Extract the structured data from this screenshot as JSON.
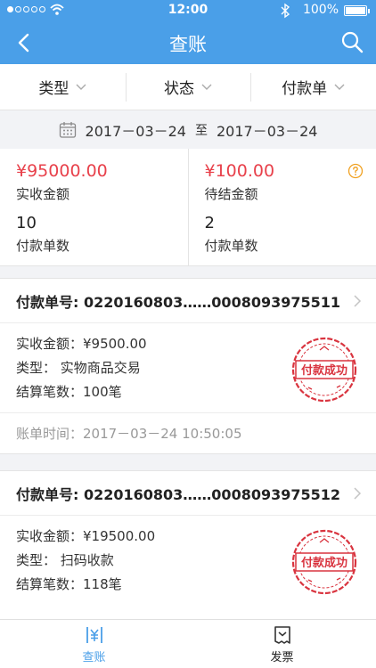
{
  "status_bar": {
    "time": "12:00",
    "battery": "100%"
  },
  "nav": {
    "title": "查账"
  },
  "filters": [
    {
      "label": "类型"
    },
    {
      "label": "状态"
    },
    {
      "label": "付款单"
    }
  ],
  "date_range": {
    "start": "2017－03－24",
    "separator": "至",
    "end": "2017－03－24"
  },
  "summary": {
    "received_amount": "¥95000.00",
    "received_label": "实收金额",
    "received_count": "10",
    "received_count_label": "付款单数",
    "pending_amount": "¥100.00",
    "pending_label": "待结金额",
    "pending_count": "2",
    "pending_count_label": "付款单数"
  },
  "cards": [
    {
      "order_no": "付款单号: 0220160803……0008093975511",
      "amount": "实收金额：¥9500.00",
      "type": "类型：  实物商品交易",
      "settle": "结算笔数：100笔",
      "stamp": "付款成功",
      "bill_time": "账单时间：2017－03－24  10:50:05"
    },
    {
      "order_no": "付款单号: 0220160803……0008093975512",
      "amount": "实收金额：¥19500.00",
      "type": "类型：  扫码收款",
      "settle": "结算笔数：118笔",
      "stamp": "付款成功"
    }
  ],
  "tabs": [
    {
      "label": "查账",
      "active": true
    },
    {
      "label": "发票",
      "active": false
    }
  ],
  "colors": {
    "brand": "#4a9fe8",
    "amount_red": "#e8414b",
    "stamp_red": "#d9343f"
  }
}
